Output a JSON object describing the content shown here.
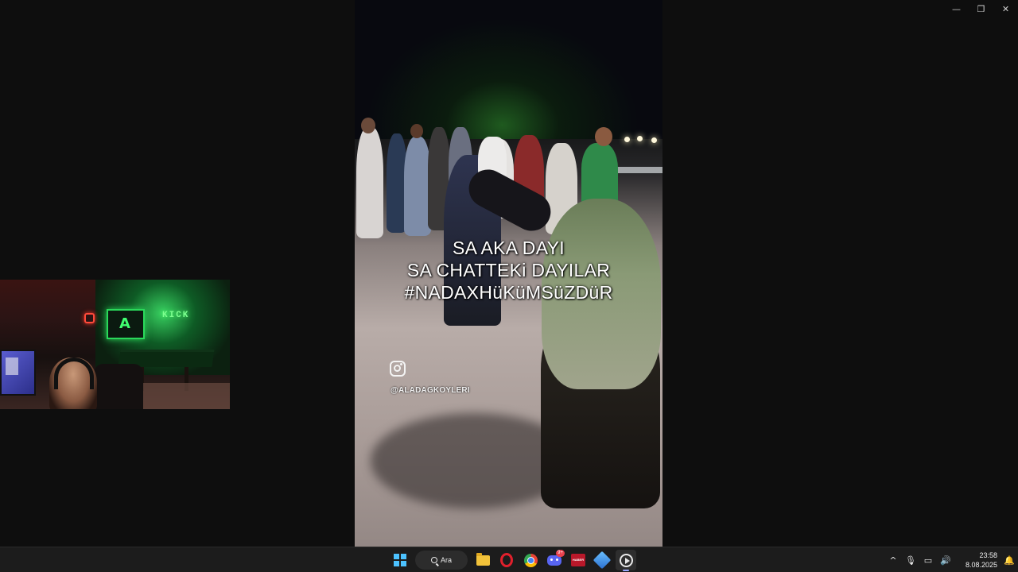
{
  "window": {
    "minimize_label": "—",
    "restore_label": "❐",
    "close_label": "✕"
  },
  "video": {
    "caption_lines": [
      "SA AKA DAYI",
      "SA CHATTEKi DAYILAR",
      "#NADAXHüKüMSüZDüR"
    ],
    "instagram_handle": "@ALADAGKOYLERI",
    "icon": "instagram-icon"
  },
  "webcam": {
    "neon_sign": "KICK",
    "tv_logo": "A"
  },
  "taskbar": {
    "search_label": "Ara",
    "apps": [
      {
        "name": "file-explorer",
        "icon": "folder-icon"
      },
      {
        "name": "opera",
        "icon": "opera-icon"
      },
      {
        "name": "chrome",
        "icon": "chrome-icon"
      },
      {
        "name": "discord",
        "icon": "discord-icon",
        "badge": "9+"
      },
      {
        "name": "news-app",
        "icon": "news-icon",
        "label": "HABER"
      },
      {
        "name": "cube-app",
        "icon": "cube-icon"
      },
      {
        "name": "media-player",
        "icon": "play-icon",
        "active": true
      }
    ],
    "tray": {
      "chevron": "^",
      "mic": "🎙",
      "network": "▭",
      "volume": "🔊"
    },
    "clock": {
      "time": "23:58",
      "date": "8.08.2025"
    },
    "colors": {
      "accent": "#4cc2ff",
      "taskbar_bg": "#1c1c1c"
    }
  }
}
